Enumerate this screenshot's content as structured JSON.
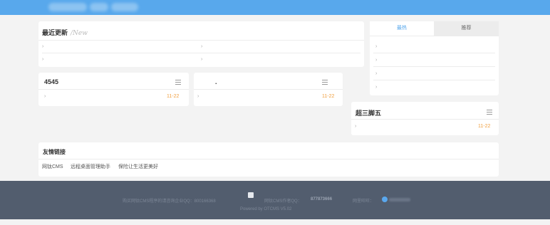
{
  "latest": {
    "title": "最近更新",
    "subtitle": "/New"
  },
  "tabs": {
    "hot": "最热",
    "recommend": "推荐"
  },
  "box1": {
    "title": "4545",
    "date": "11-22"
  },
  "box2": {
    "title": ".",
    "date": "11-22"
  },
  "box3": {
    "title": "超三脚五",
    "date": "11-22"
  },
  "friends": {
    "title": "友情链接",
    "links": [
      "网钛CMS",
      "远程桌面管理助手",
      "保险让生活更美好"
    ]
  },
  "footer": {
    "line1_a": "购买网钛CMS程序的请咨询企业QQ：800166368",
    "line1_b": "网钛CMS作者QQ：",
    "qq": "877873666",
    "line1_c": "网里旺旺：",
    "line2": "Powered by OTCMS V5.02"
  },
  "colors": {
    "topbar": "#58a8ec",
    "accent_tab": "#58a8ec",
    "date": "#f0a040",
    "footer": "#525d6e"
  }
}
